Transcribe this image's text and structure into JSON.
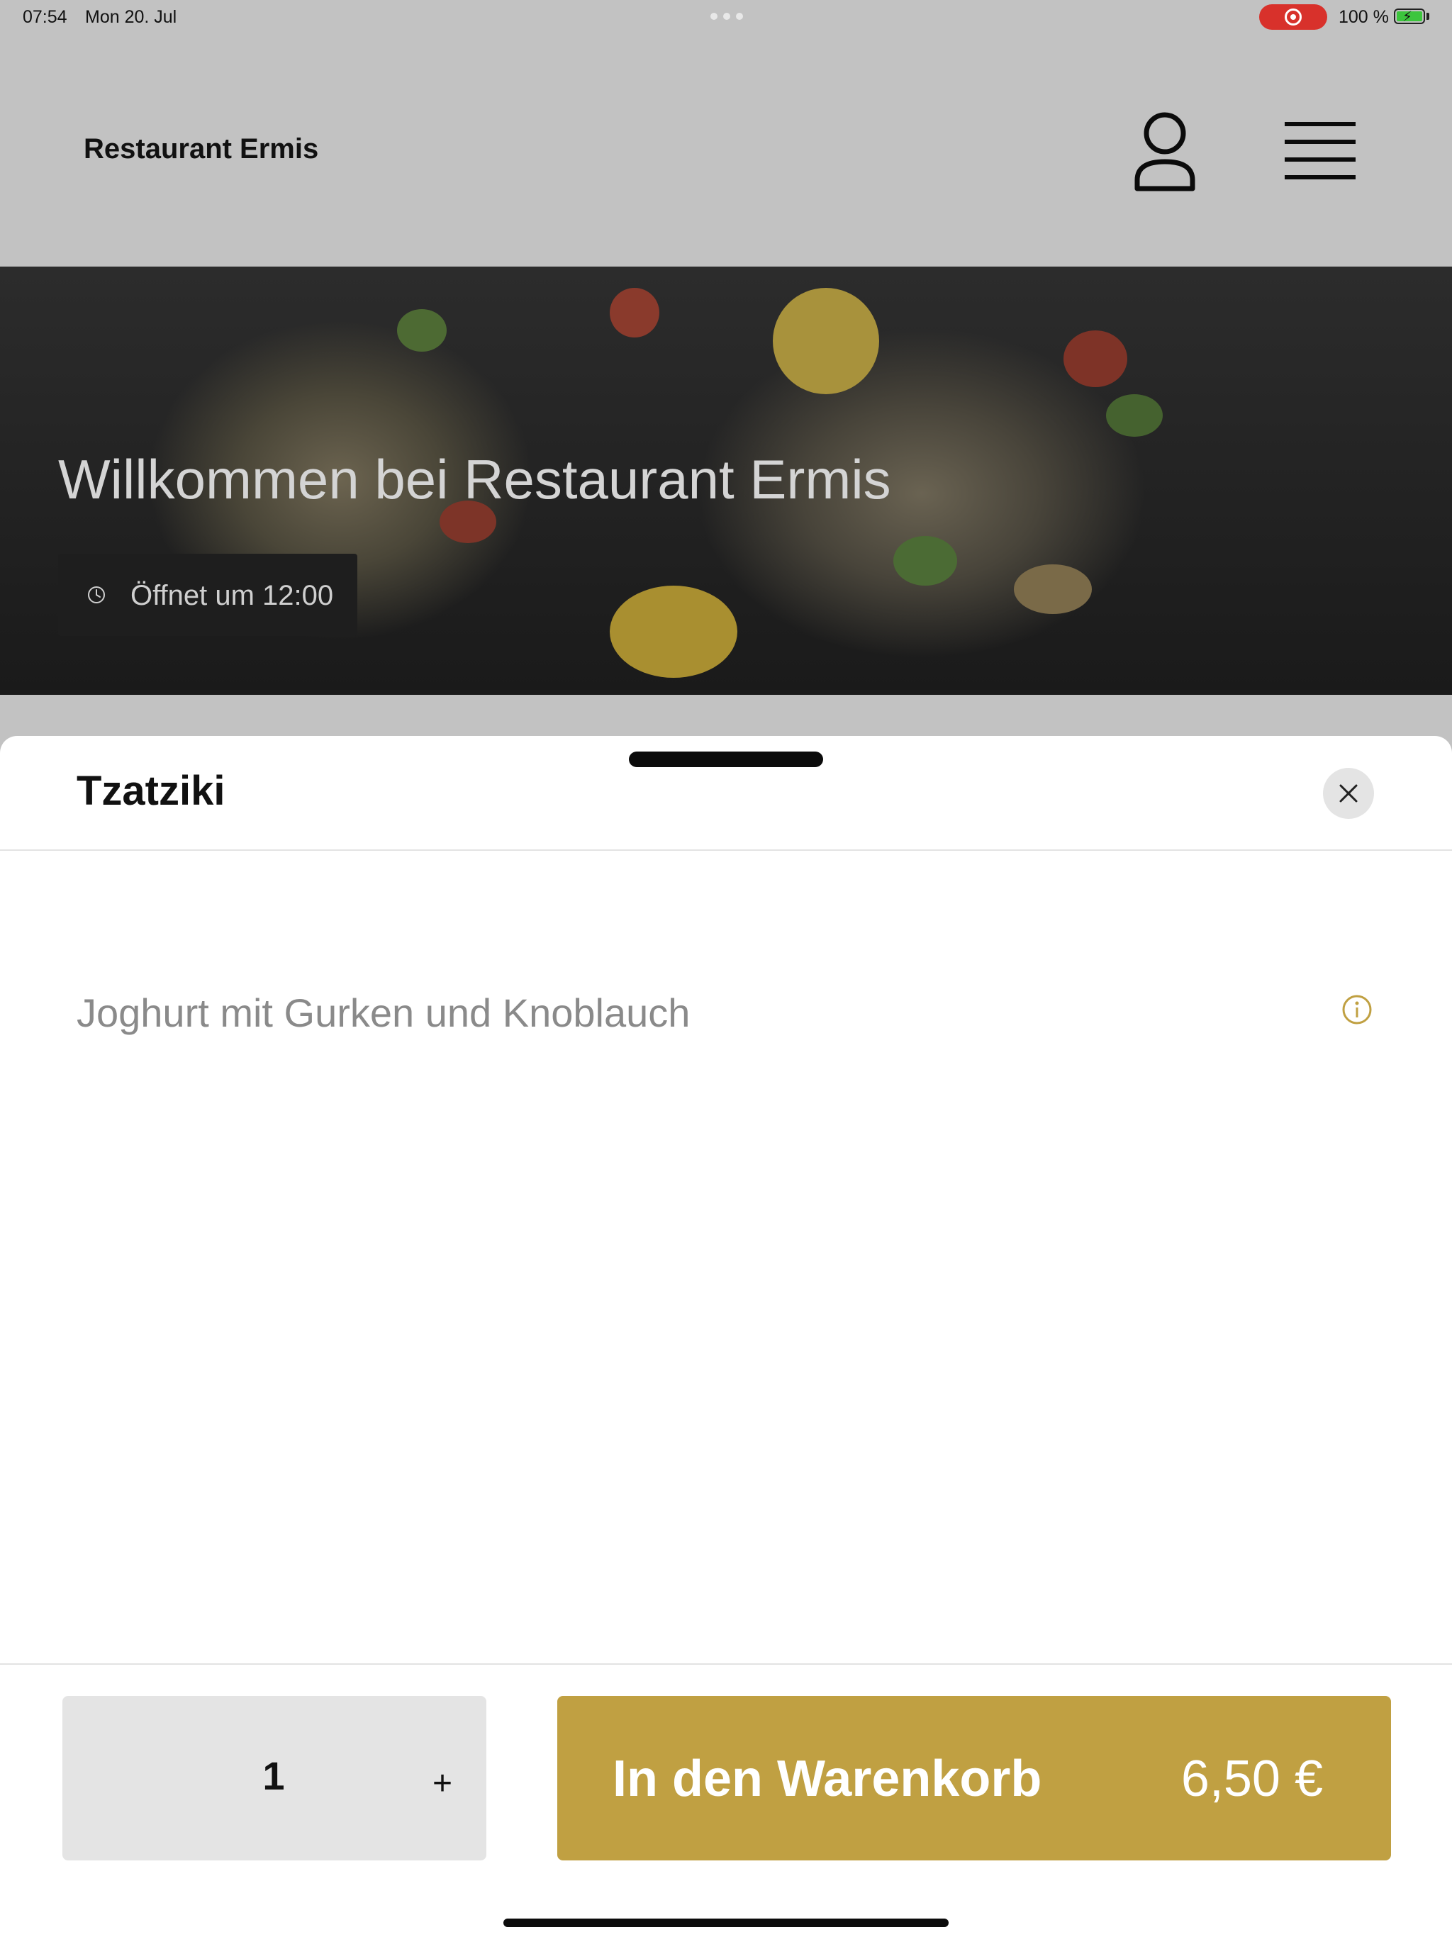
{
  "status_bar": {
    "time": "07:54",
    "date": "Mon 20. Jul",
    "battery_percent": "100 %",
    "recording_color": "#d8312b"
  },
  "header": {
    "brand": "Restaurant Ermis",
    "icons": [
      "user-icon",
      "hamburger-menu-icon"
    ]
  },
  "hero": {
    "title": "Willkommen bei Restaurant Ermis",
    "opening_text": "Öffnet um 12:00",
    "icon": "clock-icon"
  },
  "sheet": {
    "item_title": "Tzatziki",
    "description": "Joghurt mit Gurken und Knoblauch",
    "close_icon": "close-icon",
    "info_icon": "info-icon"
  },
  "order": {
    "quantity": "1",
    "plus_label": "+",
    "add_to_cart_label": "In den Warenkorb",
    "price": "6,50 €",
    "accent_color": "#c0a042"
  }
}
